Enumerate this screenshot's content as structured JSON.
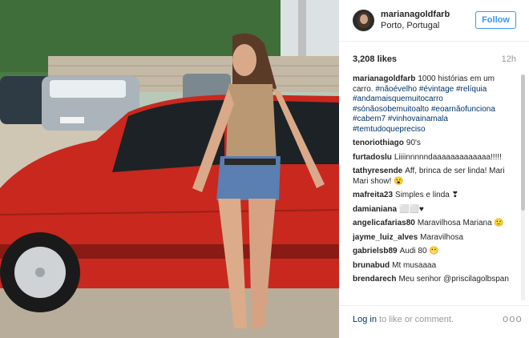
{
  "header": {
    "username": "marianagoldfarb",
    "location": "Porto, Portugal",
    "follow_label": "Follow"
  },
  "stats": {
    "likes": "3,208 likes",
    "time": "12h"
  },
  "caption": {
    "user": "marianagoldfarb",
    "text": "1000 histórias em um carro.",
    "tags": "#nãoévelho #évintage #relíquia #andamaisquemuitocarro #sónãosobemuitoalto #eoarnãofunciona #cabem7 #vinhovainamala #temtudoquepreciso"
  },
  "comments": [
    {
      "user": "tenoriothiago",
      "text": "90's"
    },
    {
      "user": "furtadoslu",
      "text": "Liiiinnnnndaaaaaaaaaaaaa!!!!!"
    },
    {
      "user": "tathyresende",
      "text": "Aff, brinca de ser linda! Mari Mari show! 😮"
    },
    {
      "user": "mafreita23",
      "text": "Simples e linda ❣"
    },
    {
      "user": "damianiana",
      "text": "⬜⬜♥"
    },
    {
      "user": "angelicafarias80",
      "text": "Maravilhosa Mariana 🙂"
    },
    {
      "user": "jayme_luiz_alves",
      "text": "Maravilhosa"
    },
    {
      "user": "gabrielsb89",
      "text": "Audi 80 😬"
    },
    {
      "user": "brunabud",
      "text": "Mt musaaaa"
    },
    {
      "user": "brendarech",
      "text": "Meu senhor @priscilagolbspan"
    }
  ],
  "footer": {
    "login_link": "Log in",
    "login_rest": " to like or comment.",
    "more_label": "ooo"
  },
  "colors": {
    "accent": "#3897f0",
    "link": "#003569",
    "car": "#c8281e"
  }
}
